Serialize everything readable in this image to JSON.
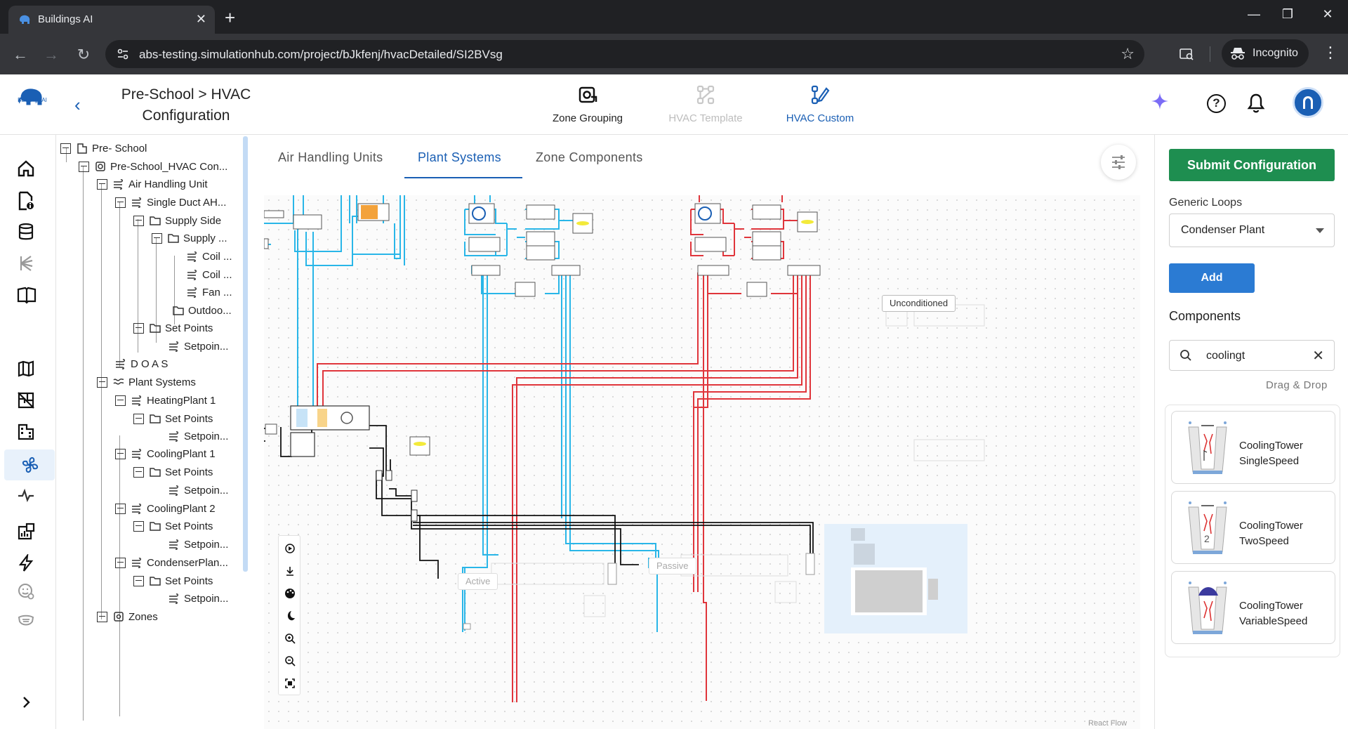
{
  "browser": {
    "tab_title": "Buildings AI",
    "url": "abs-testing.simulationhub.com/project/bJkfenj/hvacDetailed/SI2BVsg",
    "incognito_label": "Incognito"
  },
  "header": {
    "logo_text": "Buildings AI",
    "breadcrumb_line1": "Pre-School > HVAC",
    "breadcrumb_line2": "Configuration",
    "steps": [
      {
        "label": "Zone Grouping",
        "state": "done"
      },
      {
        "label": "HVAC Template",
        "state": "disabled"
      },
      {
        "label": "HVAC Custom",
        "state": "active"
      }
    ]
  },
  "tree": {
    "items": [
      {
        "label": "Pre- School"
      },
      {
        "label": "Pre-School_HVAC Con..."
      },
      {
        "label": "Air Handling Unit"
      },
      {
        "label": "Single Duct AH..."
      },
      {
        "label": "Supply Side"
      },
      {
        "label": "Supply ..."
      },
      {
        "label": "Coil ..."
      },
      {
        "label": "Coil ..."
      },
      {
        "label": "Fan ..."
      },
      {
        "label": "Outdoo..."
      },
      {
        "label": "Set Points"
      },
      {
        "label": "Setpoin..."
      },
      {
        "label": "D O A S"
      },
      {
        "label": "Plant Systems"
      },
      {
        "label": "HeatingPlant 1"
      },
      {
        "label": "Set Points"
      },
      {
        "label": "Setpoin..."
      },
      {
        "label": "CoolingPlant 1"
      },
      {
        "label": "Set Points"
      },
      {
        "label": "Setpoin..."
      },
      {
        "label": "CoolingPlant 2"
      },
      {
        "label": "Set Points"
      },
      {
        "label": "Setpoin..."
      },
      {
        "label": "CondenserPlan..."
      },
      {
        "label": "Set Points"
      },
      {
        "label": "Setpoin..."
      },
      {
        "label": "Zones"
      }
    ]
  },
  "canvas": {
    "tabs": [
      "Air Handling Units",
      "Plant Systems",
      "Zone Components"
    ],
    "active_tab": "Plant Systems",
    "labels": {
      "unconditioned": "Unconditioned",
      "active": "Active",
      "passive": "Passive"
    },
    "attribution": "React Flow"
  },
  "right_panel": {
    "submit_label": "Submit Configuration",
    "generic_loops_label": "Generic Loops",
    "generic_loops_value": "Condenser Plant",
    "add_label": "Add",
    "components_title": "Components",
    "search_value": "coolingt",
    "drag_hint": "Drag & Drop",
    "components": [
      {
        "line1": "CoolingTower",
        "line2": "SingleSpeed"
      },
      {
        "line1": "CoolingTower",
        "line2": "TwoSpeed"
      },
      {
        "line1": "CoolingTower",
        "line2": "VariableSpeed"
      }
    ]
  },
  "colors": {
    "accent": "#1a5fb4",
    "submit": "#1e8e50",
    "chilled_loop": "#29b6e8",
    "hot_loop": "#e0353b"
  }
}
